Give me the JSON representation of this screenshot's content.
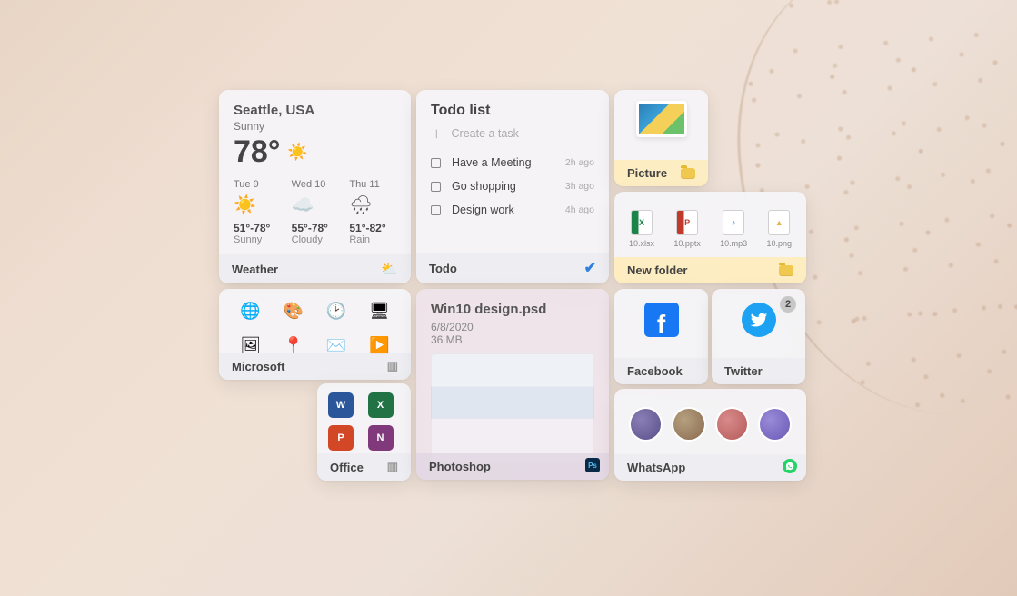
{
  "weather": {
    "city": "Seattle, USA",
    "condition": "Sunny",
    "temp": "78°",
    "icon": "☀️",
    "footer": "Weather",
    "days": [
      {
        "name": "Tue 9",
        "icon": "☀️",
        "range": "51°-78°",
        "cond": "Sunny"
      },
      {
        "name": "Wed 10",
        "icon": "☁️",
        "range": "55°-78°",
        "cond": "Cloudy"
      },
      {
        "name": "Thu 11",
        "icon": "🌧",
        "range": "51°-82°",
        "cond": "Rain"
      }
    ]
  },
  "todo": {
    "title": "Todo list",
    "create": "Create a task",
    "footer": "Todo",
    "tasks": [
      {
        "title": "Have a Meeting",
        "ago": "2h ago"
      },
      {
        "title": "Go shopping",
        "ago": "3h ago"
      },
      {
        "title": "Design work",
        "ago": "4h ago"
      }
    ]
  },
  "picture": {
    "footer": "Picture"
  },
  "newfolder": {
    "footer": "New folder",
    "files": [
      {
        "label": "10.xlsx",
        "type": "xlsx",
        "glyph": "X"
      },
      {
        "label": "10.pptx",
        "type": "pptx",
        "glyph": "P"
      },
      {
        "label": "10.mp3",
        "type": "mp3",
        "glyph": "♪"
      },
      {
        "label": "10.png",
        "type": "png",
        "glyph": "▲"
      }
    ]
  },
  "msgroup": {
    "footer": "Microsoft",
    "apps": [
      {
        "name": "edge",
        "glyph": "🌐",
        "col": "#0f7cba"
      },
      {
        "name": "paint",
        "glyph": "🎨",
        "col": "#2a8"
      },
      {
        "name": "clock",
        "glyph": "🕑",
        "col": "#555"
      },
      {
        "name": "screen",
        "glyph": "🖥",
        "col": "#27a"
      },
      {
        "name": "photos",
        "glyph": "🖼",
        "col": "#27a"
      },
      {
        "name": "maps",
        "glyph": "📍",
        "col": "#e25"
      },
      {
        "name": "mail",
        "glyph": "✉️",
        "col": "#2a8"
      },
      {
        "name": "video",
        "glyph": "▶️",
        "col": "#111"
      }
    ]
  },
  "office": {
    "footer": "Office",
    "apps": [
      {
        "name": "word",
        "glyph": "W",
        "bg": "#2b579a"
      },
      {
        "name": "excel",
        "glyph": "X",
        "bg": "#217346"
      },
      {
        "name": "powerpoint",
        "glyph": "P",
        "bg": "#d24726"
      },
      {
        "name": "onenote",
        "glyph": "N",
        "bg": "#80397b"
      }
    ]
  },
  "psd": {
    "title": "Win10 design.psd",
    "date": "6/8/2020",
    "size": "36 MB",
    "footer": "Photoshop",
    "badge": "Ps"
  },
  "facebook": {
    "footer": "Facebook"
  },
  "twitter": {
    "footer": "Twitter",
    "badge": "2"
  },
  "whatsapp": {
    "footer": "WhatsApp"
  }
}
